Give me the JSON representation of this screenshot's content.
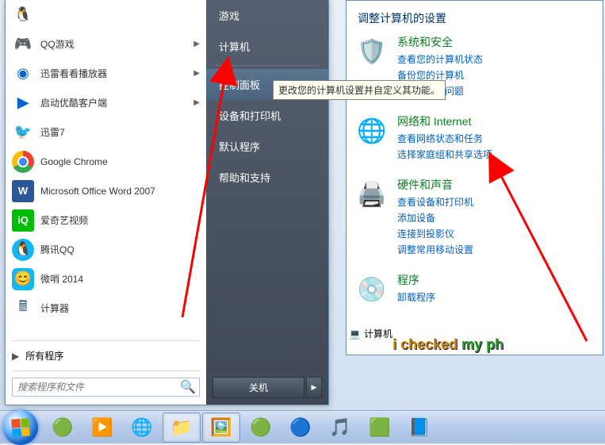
{
  "start_menu": {
    "apps": [
      {
        "label": "",
        "icon": "qq-app"
      },
      {
        "label": "QQ游戏",
        "icon": "qqgame",
        "arrow": true
      },
      {
        "label": "迅雷看看播放器",
        "icon": "xunlei-kankan",
        "arrow": true
      },
      {
        "label": "启动优酷客户端",
        "icon": "youku",
        "arrow": true
      },
      {
        "label": "迅雷7",
        "icon": "xunlei7"
      },
      {
        "label": "Google Chrome",
        "icon": "chrome"
      },
      {
        "label": "Microsoft Office Word 2007",
        "icon": "word"
      },
      {
        "label": "爱奇艺视频",
        "icon": "iqiyi"
      },
      {
        "label": "腾讯QQ",
        "icon": "tencent-qq"
      },
      {
        "label": "微哨 2014",
        "icon": "weihou"
      },
      {
        "label": "计算器",
        "icon": "calculator"
      }
    ],
    "all_programs": "所有程序",
    "search_placeholder": "搜索程序和文件",
    "right_items": [
      "游戏",
      "计算机",
      "控制面板",
      "设备和打印机",
      "默认程序",
      "帮助和支持"
    ],
    "shutdown": "关机"
  },
  "tooltip": "更改您的计算机设置并自定义其功能。",
  "control_panel": {
    "title": "调整计算机的设置",
    "categories": [
      {
        "title": "系统和安全",
        "links": [
          "查看您的计算机状态",
          "备份您的计算机",
          "查找并解决问题"
        ],
        "icon": "shield"
      },
      {
        "title": "网络和 Internet",
        "links": [
          "查看网络状态和任务",
          "选择家庭组和共享选项"
        ],
        "icon": "network"
      },
      {
        "title": "硬件和声音",
        "links": [
          "查看设备和打印机",
          "添加设备",
          "连接到投影仪",
          "调整常用移动设置"
        ],
        "icon": "hardware"
      },
      {
        "title": "程序",
        "links": [
          "卸载程序"
        ],
        "icon": "programs"
      }
    ],
    "breadcrumb": "计算机"
  },
  "subtitle_text": "i checked my phone",
  "taskbar_icons": [
    "pinwheel",
    "player",
    "ie",
    "explorer",
    "image",
    "ie-green",
    "baidu",
    "kugou",
    "360",
    "picker"
  ]
}
